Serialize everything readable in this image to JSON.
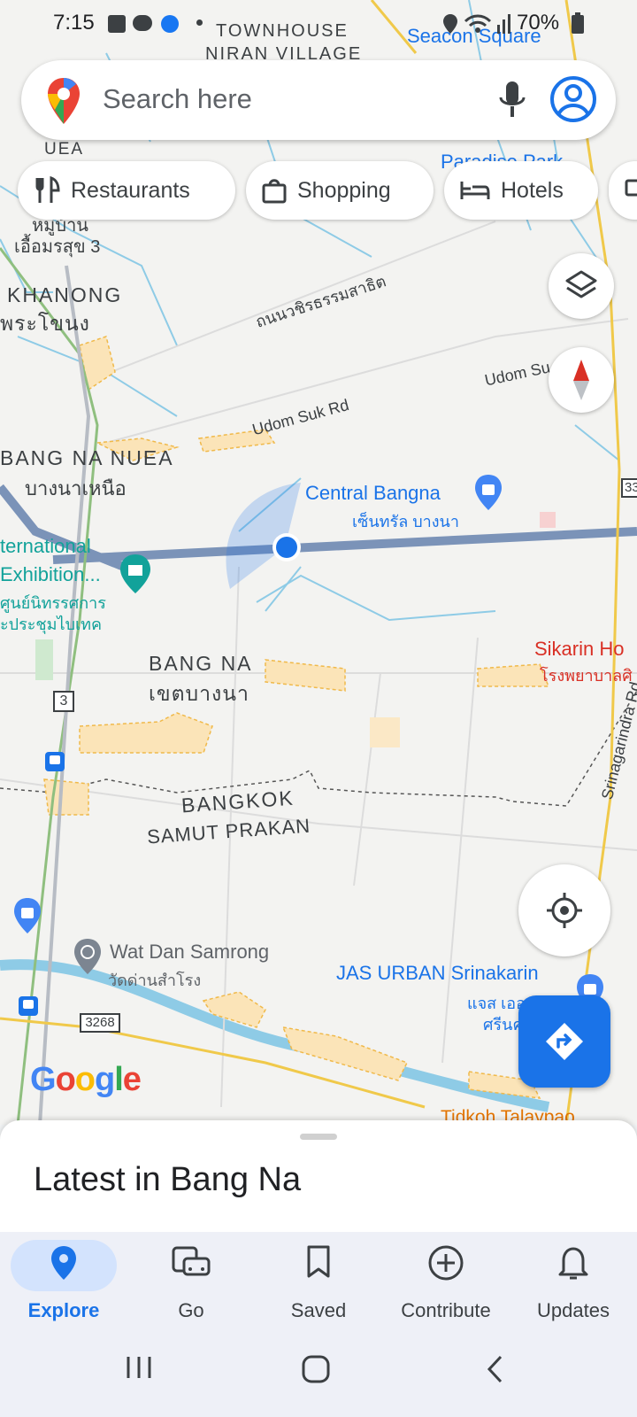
{
  "status_bar": {
    "time": "7:15",
    "battery": "70%"
  },
  "search": {
    "placeholder": "Search here"
  },
  "chips": [
    {
      "label": "Restaurants",
      "icon": "restaurant-icon"
    },
    {
      "label": "Shopping",
      "icon": "shopping-bag-icon"
    },
    {
      "label": "Hotels",
      "icon": "bed-icon"
    }
  ],
  "map": {
    "labels": {
      "townhouse": "TOWNHOUSE",
      "niran": "NIRAN VILLAGE",
      "seacon": "Seacon Square",
      "uea": "UEA",
      "paradise": "Paradise Park",
      "moo_baan": "หมู่บ้าน",
      "uemsuk": "เอื้อมรสุข 3",
      "khanong": "KHANONG",
      "phra_khanong": "พระโขนง",
      "wachira_road": "ถนนวชิรธรรมสาธิต",
      "udom_suk_1": "Udom Suk Rd",
      "udom_suk_2": "Udom Su",
      "bang_na_nuea": "BANG NA NUEA",
      "bang_na_nuea_th": "บางนาเหนือ",
      "central_bangna": "Central Bangna",
      "central_bangna_th": "เซ็นทรัล บางนา",
      "intl_1": "ternational",
      "intl_2": "Exhibition...",
      "intl_th_1": "ศูนย์นิทรรศการ",
      "intl_th_2": "ะประชุมไบเทค",
      "bang_na": "BANG NA",
      "bang_na_th": "เขตบางนา",
      "sikarin": "Sikarin Ho",
      "sikarin_th": "โรงพยาบาลศิ",
      "bangkok": "BANGKOK",
      "samut_prakan": "SAMUT PRAKAN",
      "srinagarindra": "Srinagarindra Rd",
      "wat_dan": "Wat Dan Samrong",
      "wat_dan_th": "วัดด่านสำโรง",
      "jas_urban": "JAS URBAN Srinakarin",
      "jas_th_1": "แจส เออ",
      "jas_th_2": "ศรีนค",
      "tidkoh": "Tidkoh Talaypao",
      "route_3": "3",
      "route_3268": "3268",
      "route_33": "33",
      "google": "Google"
    }
  },
  "sheet": {
    "title": "Latest in Bang Na"
  },
  "nav": [
    {
      "label": "Explore",
      "active": true
    },
    {
      "label": "Go"
    },
    {
      "label": "Saved"
    },
    {
      "label": "Contribute"
    },
    {
      "label": "Updates"
    }
  ],
  "colors": {
    "accent": "#1a73e8",
    "map_bg": "#f3f3f1",
    "highway": "#7b93b8",
    "water": "#8ecbe6"
  }
}
